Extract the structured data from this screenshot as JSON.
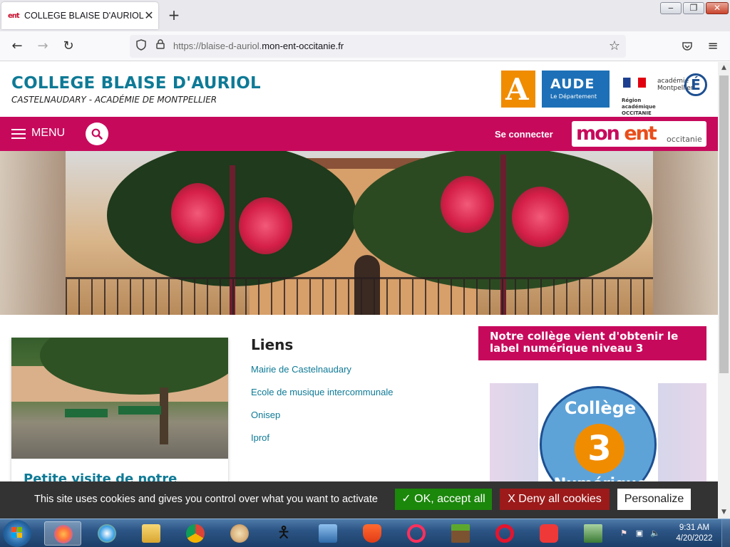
{
  "browser": {
    "tab_title": "COLLEGE BLAISE D'AURIOL",
    "tab_favicon": "ent",
    "tab_close": "✕",
    "new_tab": "+",
    "url_prefix": "https://blaise-d-auriol.",
    "url_domain": "mon-ent-occitanie.fr",
    "window_minimize": "‒",
    "window_maximize": "❐",
    "window_close": "✕",
    "back": "←",
    "forward": "→",
    "reload": "↻",
    "shield": "⛉",
    "lock": "🔒",
    "bookmark": "☆",
    "pocket": "⛉",
    "menu": "≡"
  },
  "header": {
    "title": "COLLEGE BLAISE D'AURIOL",
    "subtitle": "CASTELNAUDARY - ACADÉMIE DE MONTPELLIER",
    "logo_aude_letter": "A",
    "logo_aude_name": "AUDE",
    "logo_aude_sub": "Le Département",
    "region_line1": "Région académique",
    "region_line2": "OCCITANIE",
    "acad_text": "académie Montpellier",
    "acad_letter": "É"
  },
  "menubar": {
    "menu_label": "MENU",
    "login_label": "Se connecter",
    "ent_part1": "mon ",
    "ent_part2": "ent",
    "ent_sub": "occitanie"
  },
  "content": {
    "card_title": "Petite visite de notre collège",
    "links_heading": "Liens",
    "links": [
      "Mairie de Castelnaudary",
      "Ecole de musique intercommunale",
      "Onisep",
      "Iprof"
    ],
    "news_title": "Notre collège vient d'obtenir le label numérique niveau 3",
    "badge_top": "Collège",
    "badge_num": "3",
    "badge_bottom": "Numérique"
  },
  "cookies": {
    "text": "This site uses cookies and gives you control over what you want to activate",
    "ok": "✓ OK, accept all",
    "deny": "X  Deny all cookies",
    "personalize": "Personalize"
  },
  "taskbar": {
    "time": "9:31 AM",
    "date": "4/20/2022",
    "apps": [
      "firefox-icon",
      "ie-icon",
      "explorer-icon",
      "chrome-icon",
      "paint-icon",
      "stickman-icon",
      "control-panel-icon",
      "brave-icon",
      "opera-gx-icon",
      "minecraft-icon",
      "opera-icon",
      "vivaldi-icon",
      "network-app-icon"
    ]
  },
  "colors": {
    "brand_blue": "#0e7a96",
    "brand_magenta": "#c7095c",
    "cookie_ok": "#1b870b",
    "cookie_deny": "#9c1a1a"
  }
}
